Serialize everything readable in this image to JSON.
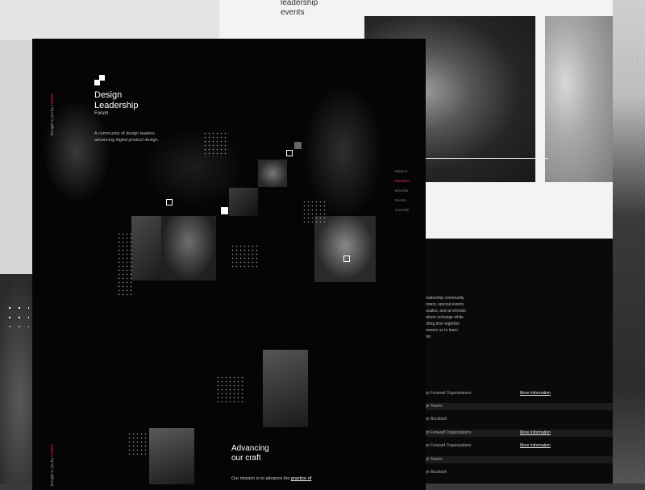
{
  "back_sheet": {
    "heading": "leadership\nevents"
  },
  "back_lower": {
    "paragraph": "leadership community\ninners, special events\nlocales, and at retreats\nmbers recharge while\nnding time together.\npowers us to learn\nner.",
    "rows": [
      {
        "label": "Design Forward Organizations",
        "more": "More Information",
        "band": false
      },
      {
        "label": "Design Teams",
        "more": "",
        "band": true
      },
      {
        "label": "Design Backlash",
        "more": "",
        "band": false
      },
      {
        "label": "Design Forward Organizations",
        "more": "More Information",
        "band": true
      },
      {
        "label": "Design Forward Organizations",
        "more": "More Information",
        "band": false
      },
      {
        "label": "Design Teams",
        "more": "",
        "band": true
      },
      {
        "label": "Design Backlash",
        "more": "",
        "band": false
      }
    ]
  },
  "front": {
    "brand_title": "Design\nLeadership",
    "brand_sub": "Forum",
    "brand_desc": "A community of design leaders advancing digital product design.",
    "vertical_credit_prefix": "brought to you by ",
    "vertical_credit_accent": "InVision",
    "nav": [
      "Mission",
      "Members",
      "Benefits",
      "Events",
      "Journals"
    ],
    "nav_active_index": 1,
    "advancing_heading": "Advancing\nour craft",
    "mission_prefix": "Our mission is to advance the ",
    "mission_link": "practice of"
  },
  "colors": {
    "accent": "#e2245a",
    "background": "#050505",
    "back_sheet": "#f3f3f3"
  }
}
